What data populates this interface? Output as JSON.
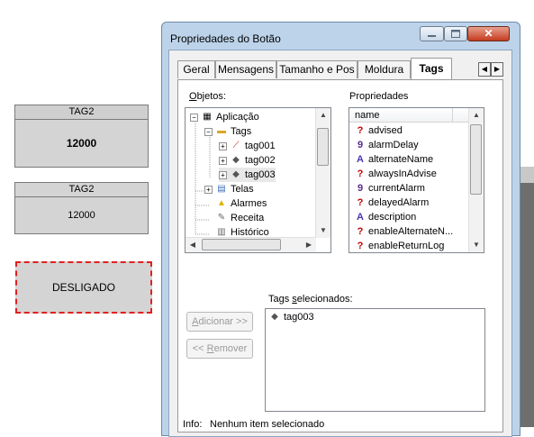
{
  "canvas": {
    "widget1": {
      "header": "TAG2",
      "value": "12000"
    },
    "widget2": {
      "header": "TAG2",
      "value": "12000"
    },
    "widget3": {
      "text": "DESLIGADO"
    }
  },
  "dialog": {
    "title": "Propriedades do Botão",
    "close_glyph": "✕",
    "tabs": [
      {
        "label": "Geral"
      },
      {
        "label": "Mensagens"
      },
      {
        "label": "Tamanho e Pos"
      },
      {
        "label": "Moldura"
      },
      {
        "label": "Tags",
        "active": true
      }
    ],
    "objects_label_prefix": "O",
    "objects_label_rest": "bjetos:",
    "properties_label": "Propriedades",
    "tree": [
      {
        "label": "Aplicação",
        "icon": "app-icon",
        "expander": "−"
      },
      {
        "label": "Tags",
        "icon": "folder-icon",
        "expander": "−"
      },
      {
        "label": "tag001",
        "icon": "line-chart-icon",
        "expander": "+"
      },
      {
        "label": "tag002",
        "icon": "tag-icon",
        "expander": "+"
      },
      {
        "label": "tag003",
        "icon": "tag-icon",
        "expander": "+"
      },
      {
        "label": "Telas",
        "icon": "screens-icon",
        "expander": "+"
      },
      {
        "label": "Alarmes",
        "icon": "alarm-icon"
      },
      {
        "label": "Receita",
        "icon": "recipe-icon"
      },
      {
        "label": "Histórico",
        "icon": "history-icon"
      }
    ],
    "properties_column": "name",
    "properties": [
      {
        "label": "advised",
        "icon": "?"
      },
      {
        "label": "alarmDelay",
        "icon": "9"
      },
      {
        "label": "alternateName",
        "icon": "A"
      },
      {
        "label": "alwaysInAdvise",
        "icon": "?"
      },
      {
        "label": "currentAlarm",
        "icon": "9"
      },
      {
        "label": "delayedAlarm",
        "icon": "?"
      },
      {
        "label": "description",
        "icon": "A"
      },
      {
        "label": "enableAlternateN...",
        "icon": "?"
      },
      {
        "label": "enableReturnLog",
        "icon": "?"
      }
    ],
    "selected_label_prefix": "Tags ",
    "selected_label_underlined": "s",
    "selected_label_rest": "elecionados:",
    "selected_items": [
      {
        "label": "tag003",
        "icon": "tag-icon"
      }
    ],
    "add_button_u": "A",
    "add_button_rest": "dicionar >>",
    "remove_button_prefix": "<< ",
    "remove_button_u": "R",
    "remove_button_rest": "emover",
    "info_label": "Info:",
    "info_text": "Nenhum item selecionado"
  }
}
